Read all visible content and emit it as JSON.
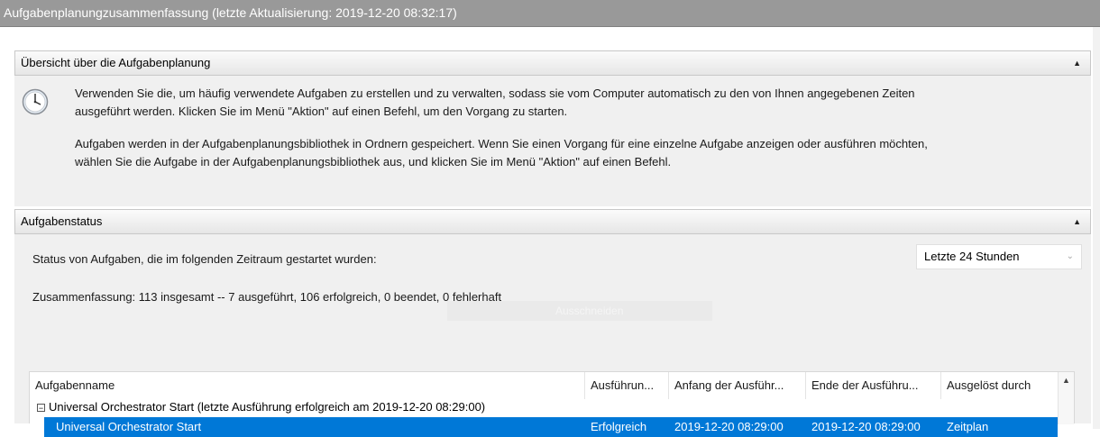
{
  "window": {
    "title": "Aufgabenplanungzusammenfassung (letzte Aktualisierung: 2019-12-20 08:32:17)"
  },
  "overview": {
    "header": "Übersicht über die Aufgabenplanung",
    "icon": "clock-icon",
    "para1_line1": "Verwenden Sie die, um häufig verwendete Aufgaben zu erstellen und zu verwalten, sodass sie vom Computer automatisch zu den von Ihnen angegebenen Zeiten",
    "para1_line2": "ausgeführt werden. Klicken Sie im Menü \"Aktion\" auf einen Befehl, um den Vorgang zu starten.",
    "para2_line1": "Aufgaben werden in der Aufgabenplanungsbibliothek in Ordnern gespeichert. Wenn Sie einen Vorgang für eine einzelne Aufgabe anzeigen oder ausführen möchten,",
    "para2_line2": "wählen Sie die Aufgabe in der Aufgabenplanungsbibliothek aus, und klicken Sie im Menü \"Aktion\" auf einen Befehl."
  },
  "status": {
    "header": "Aufgabenstatus",
    "period_label": "Status von Aufgaben, die im folgenden Zeitraum gestartet wurden:",
    "period_value": "Letzte 24 Stunden",
    "summary": "Zusammenfassung: 113 insgesamt -- 7 ausgeführt, 106 erfolgreich, 0 beendet, 0 fehlerhaft",
    "ghost_text": "Ausschneiden"
  },
  "table": {
    "columns": [
      "Aufgabenname",
      "Ausführun...",
      "Anfang der Ausführ...",
      "Ende der Ausführu...",
      "Ausgelöst durch"
    ],
    "group": "Universal Orchestrator Start (letzte Ausführung erfolgreich am 2019-12-20 08:29:00)",
    "rows": [
      {
        "name": "Universal Orchestrator Start",
        "result": "Erfolgreich",
        "start": "2019-12-20 08:29:00",
        "end": "2019-12-20 08:29:00",
        "trigger": "Zeitplan"
      }
    ]
  },
  "colors": {
    "selection": "#0078d7",
    "titlebar": "#999999",
    "panel_bg": "#f0f0f0"
  }
}
